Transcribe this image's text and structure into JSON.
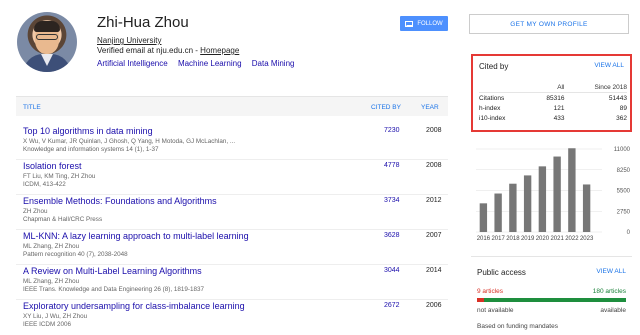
{
  "profile": {
    "name": "Zhi-Hua Zhou",
    "affiliation": "Nanjing University",
    "email_text": "Verified email at nju.edu.cn - ",
    "homepage_label": "Homepage",
    "interests": [
      "Artificial Intelligence",
      "Machine Learning",
      "Data Mining"
    ]
  },
  "actions": {
    "follow_label": "FOLLOW",
    "my_profile_label": "GET MY OWN PROFILE"
  },
  "table": {
    "headers": {
      "title": "TITLE",
      "cited_by": "CITED BY",
      "year": "YEAR"
    },
    "rows": [
      {
        "title": "Top 10 algorithms in data mining",
        "authors": "X Wu, V Kumar, JR Quinlan, J Ghosh, Q Yang, H Motoda, GJ McLachlan, ...",
        "venue": "Knowledge and information systems 14 (1), 1-37",
        "cited": "7230",
        "year": "2008"
      },
      {
        "title": "Isolation forest",
        "authors": "FT Liu, KM Ting, ZH Zhou",
        "venue": "ICDM, 413-422",
        "cited": "4778",
        "year": "2008"
      },
      {
        "title": "Ensemble Methods: Foundations and Algorithms",
        "authors": "ZH Zhou",
        "venue": "Chapman & Hall/CRC Press",
        "cited": "3734",
        "year": "2012"
      },
      {
        "title": "ML-KNN: A lazy learning approach to multi-label learning",
        "authors": "ML Zhang, ZH Zhou",
        "venue": "Pattern recognition 40 (7), 2038-2048",
        "cited": "3628",
        "year": "2007"
      },
      {
        "title": "A Review on Multi-Label Learning Algorithms",
        "authors": "ML Zhang, ZH Zhou",
        "venue": "IEEE Trans. Knowledge and Data Engineering 26 (8), 1819-1837",
        "cited": "3044",
        "year": "2014"
      },
      {
        "title": "Exploratory undersampling for class-imbalance learning",
        "authors": "XY Liu, J Wu, ZH Zhou",
        "venue": "IEEE ICDM 2006",
        "cited": "2672",
        "year": "2006"
      }
    ]
  },
  "cited_by": {
    "title": "Cited by",
    "view_all": "VIEW ALL",
    "col_all": "All",
    "col_since": "Since 2018",
    "metrics": [
      {
        "name": "Citations",
        "all": "85316",
        "since": "51443"
      },
      {
        "name": "h-index",
        "all": "121",
        "since": "89"
      },
      {
        "name": "i10-index",
        "all": "433",
        "since": "362"
      }
    ]
  },
  "chart_data": {
    "type": "bar",
    "categories": [
      "2016",
      "2017",
      "2018",
      "2019",
      "2020",
      "2021",
      "2022",
      "2023"
    ],
    "values": [
      3800,
      5100,
      6400,
      7500,
      8700,
      10000,
      11100,
      6300
    ],
    "y_ticks": [
      "11000",
      "8250",
      "5500",
      "2750",
      "0"
    ],
    "ylim": [
      0,
      11000
    ],
    "bar_color": "#777777",
    "grid": true
  },
  "public_access": {
    "title": "Public access",
    "view_all": "VIEW ALL",
    "not_available_count": "9 articles",
    "available_count": "180 articles",
    "not_available_label": "not available",
    "available_label": "available",
    "not_available_fraction": 0.048,
    "funding_note": "Based on funding mandates",
    "colors": {
      "not_available": "#d93025",
      "available": "#1e8e3e"
    }
  }
}
